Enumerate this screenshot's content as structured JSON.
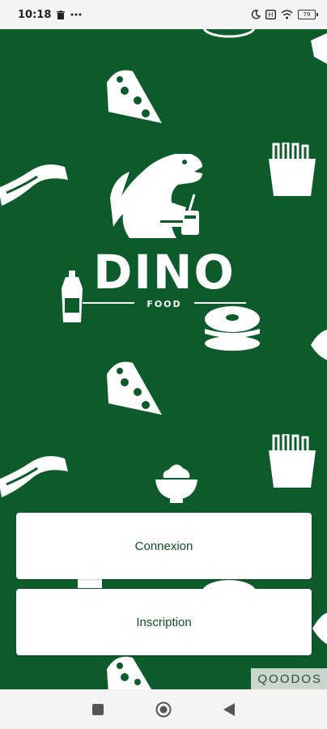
{
  "status_bar": {
    "time": "10:18",
    "battery": "79",
    "icons": [
      "trash-icon",
      "more-dots-icon",
      "moon-icon",
      "screen-record-icon",
      "wifi-icon",
      "battery-icon"
    ]
  },
  "logo": {
    "title": "DINO",
    "subtitle": "FOOD"
  },
  "buttons": {
    "login_label": "Connexion",
    "signup_label": "Inscription"
  },
  "watermark": "QOODOS",
  "nav": {
    "icons": [
      "recents-square-icon",
      "home-circle-icon",
      "back-triangle-icon"
    ]
  },
  "colors": {
    "background": "#0d5a2b",
    "button_text": "#0d4f27",
    "button_background": "#ffffff"
  }
}
